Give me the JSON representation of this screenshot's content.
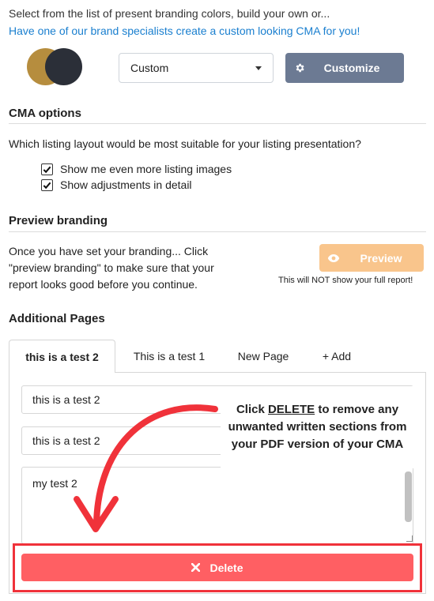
{
  "branding": {
    "intro_text": "Select from the list of present branding colors, build your own or...",
    "specialist_link": "Have one of our brand specialists create a custom looking CMA for you!",
    "swatch_colors": [
      "#b68d3e",
      "#2b2f38"
    ],
    "preset_select": {
      "value": "Custom"
    },
    "customize_button": {
      "label": "Customize",
      "icon": "gear-icon"
    }
  },
  "cma_options": {
    "title": "CMA options",
    "question": "Which listing layout would be most suitable for your listing presentation?",
    "checkboxes": [
      {
        "label": "Show me even more listing images",
        "checked": true
      },
      {
        "label": "Show adjustments in detail",
        "checked": true
      }
    ]
  },
  "preview": {
    "title": "Preview branding",
    "description": "Once you have set your branding... Click \"preview branding\" to make sure that your report looks good before you continue.",
    "button_label": "Preview",
    "button_icon": "eye-icon",
    "note": "This will NOT show your full report!"
  },
  "additional_pages": {
    "title": "Additional Pages",
    "tabs": [
      {
        "label": "this is a test 2",
        "active": true
      },
      {
        "label": "This is a test 1",
        "active": false
      },
      {
        "label": "New Page",
        "active": false
      },
      {
        "label": "+ Add",
        "active": false
      }
    ],
    "fields": {
      "page_title": "this is a test 2",
      "section_title": "this is a test 2",
      "body": "my test 2"
    },
    "delete_button": {
      "label": "Delete",
      "icon": "close-icon"
    }
  },
  "callout": {
    "before": "Click",
    "keyword": "DELETE",
    "after": "to remove any unwanted written sections from your PDF version of your CMA"
  },
  "colors": {
    "link": "#1a7fcf",
    "customize": "#6c7a93",
    "preview": "#f9c58c",
    "delete": "#ff5f63",
    "annotation": "#f0323a"
  }
}
